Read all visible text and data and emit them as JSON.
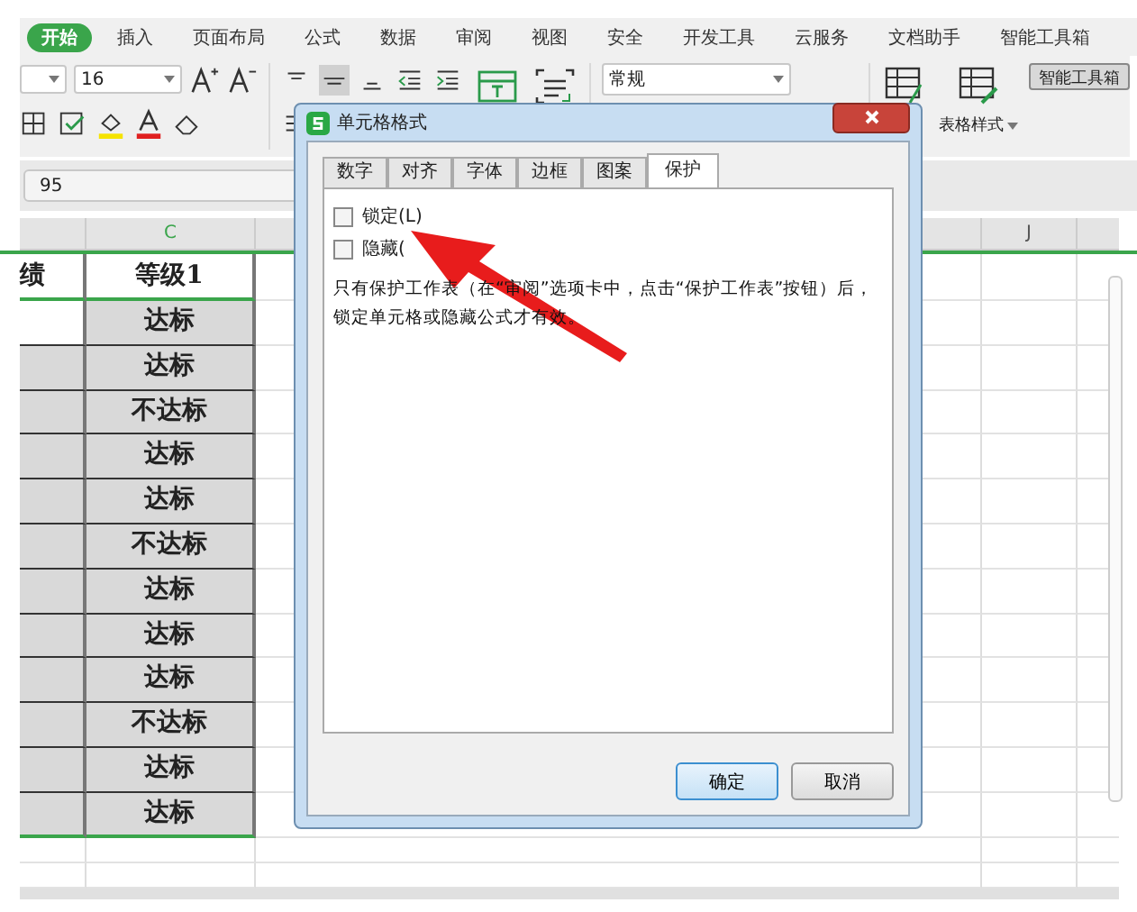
{
  "ribbon": {
    "tabs": [
      {
        "label": "开始",
        "selected": true
      },
      {
        "label": "插入",
        "selected": false
      },
      {
        "label": "页面布局",
        "selected": false
      },
      {
        "label": "公式",
        "selected": false
      },
      {
        "label": "数据",
        "selected": false
      },
      {
        "label": "审阅",
        "selected": false
      },
      {
        "label": "视图",
        "selected": false
      },
      {
        "label": "安全",
        "selected": false
      },
      {
        "label": "开发工具",
        "selected": false
      },
      {
        "label": "云服务",
        "selected": false
      },
      {
        "label": "文档助手",
        "selected": false
      },
      {
        "label": "智能工具箱",
        "selected": false
      }
    ]
  },
  "toolbar": {
    "font_size": "16",
    "number_format": "常规",
    "table_style": "表格样式",
    "toolbox": "智能工具箱"
  },
  "formula_bar": {
    "value": "95"
  },
  "sheet": {
    "column_headers": [
      "C",
      "J"
    ],
    "header_cell": "绩",
    "grade_header": "等级1",
    "grades": [
      "达标",
      "达标",
      "不达标",
      "达标",
      "达标",
      "不达标",
      "达标",
      "达标",
      "达标",
      "不达标",
      "达标",
      "达标"
    ]
  },
  "dialog": {
    "title": "单元格格式",
    "tabs": [
      {
        "label": "数字",
        "selected": false
      },
      {
        "label": "对齐",
        "selected": false
      },
      {
        "label": "字体",
        "selected": false
      },
      {
        "label": "边框",
        "selected": false
      },
      {
        "label": "图案",
        "selected": false
      },
      {
        "label": "保护",
        "selected": true
      }
    ],
    "checkboxes": [
      {
        "label": "锁定(L)",
        "checked": false
      },
      {
        "label": "隐藏(",
        "checked": false
      }
    ],
    "note": "只有保护工作表（在“审阅”选项卡中，点击“保护工作表”按钮）后，锁定单元格或隐藏公式才有效。",
    "buttons": [
      {
        "label": "确定",
        "kind": "default"
      },
      {
        "label": "取消",
        "kind": "normal"
      }
    ]
  }
}
